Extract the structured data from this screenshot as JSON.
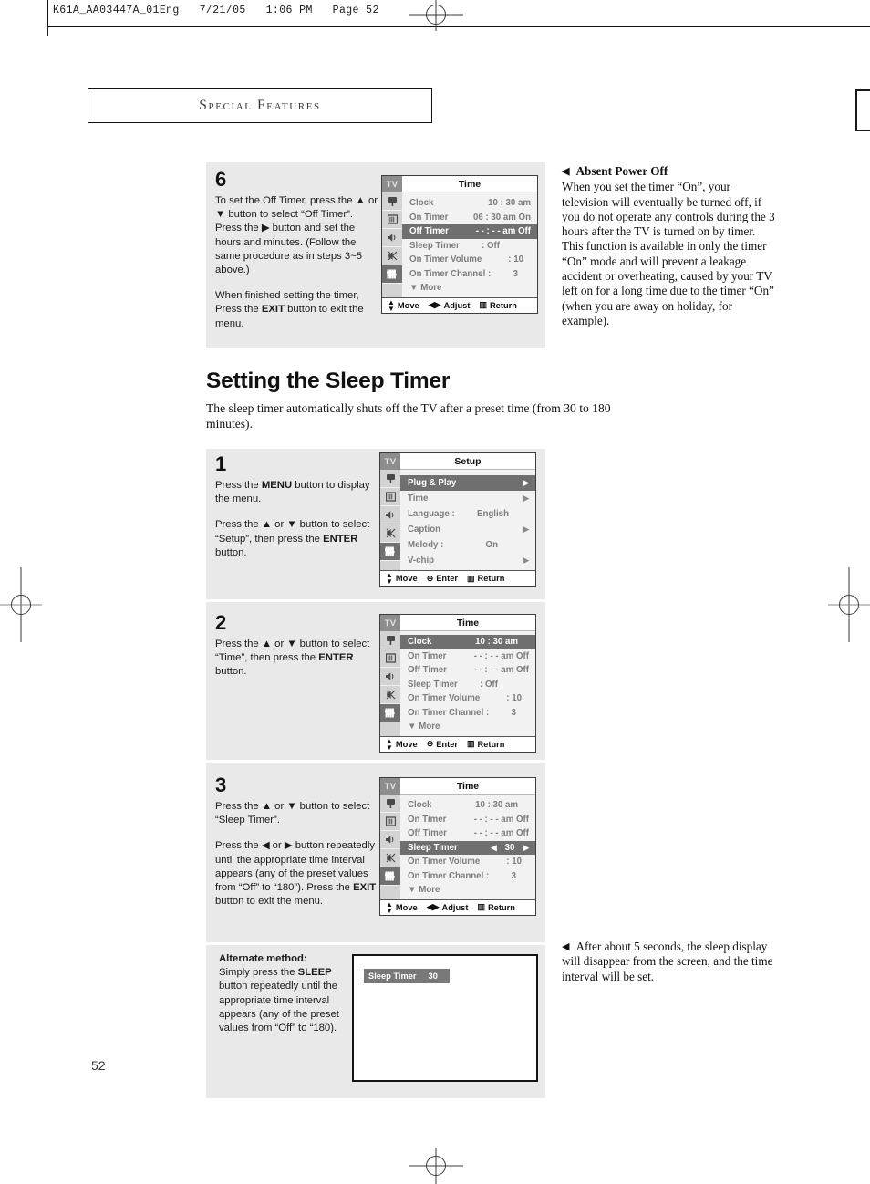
{
  "print_header": "K61A_AA03447A_01Eng   7/21/05   1:06 PM   Page 52",
  "section_title": "Special Features",
  "page_number": "52",
  "main_heading": "Setting the Sleep Timer",
  "main_intro": "The sleep timer automatically shuts off the TV after a preset time (from 30 to 180 minutes).",
  "step6": {
    "number": "6",
    "para1": "To set the Off Timer, press the ▲ or ▼ button to select “Off Timer”. Press the ▶ button and set the hours and minutes. (Follow the same procedure as in steps 3~5 above.)",
    "para2_pre": "When finished setting the timer, Press the ",
    "para2_bold": "EXIT",
    "para2_post": " button to exit the menu."
  },
  "step1": {
    "number": "1",
    "para1_pre": "Press the ",
    "para1_bold": "MENU",
    "para1_post": " button to display the menu.",
    "para2_pre": "Press the ▲ or ▼ button to select “Setup”, then press the ",
    "para2_bold": "ENTER",
    "para2_post": " button."
  },
  "step2": {
    "number": "2",
    "para1_pre": "Press the ▲ or ▼ button to select “Time”, then press the ",
    "para1_bold": "ENTER",
    "para1_post": " button."
  },
  "step3": {
    "number": "3",
    "para1": "Press the ▲ or ▼ button to select “Sleep Timer”.",
    "para2_pre": "Press the ◀ or ▶ button repeatedly until the appropriate time interval appears (any of the preset values from “Off” to “180”). Press the ",
    "para2_bold": "EXIT",
    "para2_post": " button to exit the menu."
  },
  "alternate": {
    "heading": "Alternate method:",
    "body_pre": "Simply press the ",
    "body_bold": "SLEEP",
    "body_post": " button repeatedly until the appropriate time interval appears (any of the preset values from “Off” to “180)."
  },
  "notes": {
    "absent_power_off": {
      "marker": "◀",
      "heading": "Absent Power Off",
      "body": "When you set the timer “On”, your television will eventually be turned off, if you do not operate any controls during the 3 hours after the TV is turned on by timer. This function is available in only the timer “On” mode and will prevent a leakage accident or overheating, caused by your TV left on for a long time due to the timer “On” (when you are away on holiday, for example)."
    },
    "sleep_display": {
      "marker": "◀",
      "body": "After about 5 seconds, the sleep display will disappear from the screen, and the time interval will be set."
    }
  },
  "osd_common": {
    "tv_label": "TV",
    "move_label": "Move",
    "adjust_label": "Adjust",
    "enter_label": "Enter",
    "return_label": "Return"
  },
  "osd_time_offtimer": {
    "title": "Time",
    "rows": [
      {
        "label": "Clock",
        "value": "10 : 30 am",
        "highlight": false
      },
      {
        "label": "On Timer",
        "value": "06 : 30 am On",
        "highlight": false
      },
      {
        "label": "Off Timer",
        "value": "- - : - - am Off",
        "highlight": true
      },
      {
        "label": "Sleep Timer",
        "value": ": Off",
        "highlight": false
      },
      {
        "label": "On Timer Volume",
        "value": ": 10",
        "highlight": false
      },
      {
        "label": "On Timer Channel :",
        "value": "3",
        "highlight": false
      },
      {
        "label": "▼ More",
        "value": "",
        "highlight": false
      }
    ],
    "footer": [
      "Move",
      "Adjust",
      "Return"
    ]
  },
  "osd_setup": {
    "title": "Setup",
    "rows": [
      {
        "label": "Plug & Play",
        "value": "",
        "arrow": true,
        "highlight": true
      },
      {
        "label": "Time",
        "value": "",
        "arrow": true,
        "highlight": false
      },
      {
        "label": "Language :",
        "value": "English",
        "arrow": false,
        "highlight": false
      },
      {
        "label": "Caption",
        "value": "",
        "arrow": true,
        "highlight": false
      },
      {
        "label": "Melody    :",
        "value": "On",
        "arrow": false,
        "highlight": false
      },
      {
        "label": "V-chip",
        "value": "",
        "arrow": true,
        "highlight": false
      }
    ],
    "footer": [
      "Move",
      "Enter",
      "Return"
    ]
  },
  "osd_time_clock": {
    "title": "Time",
    "rows": [
      {
        "label": "Clock",
        "value": "10 : 30 am",
        "highlight": true
      },
      {
        "label": "On Timer",
        "value": "- - : - - am Off",
        "highlight": false
      },
      {
        "label": "Off Timer",
        "value": "- - : - - am Off",
        "highlight": false
      },
      {
        "label": "Sleep Timer",
        "value": ": Off",
        "highlight": false
      },
      {
        "label": "On Timer Volume",
        "value": ": 10",
        "highlight": false
      },
      {
        "label": "On Timer Channel :",
        "value": "3",
        "highlight": false
      },
      {
        "label": "▼ More",
        "value": "",
        "highlight": false
      }
    ],
    "footer": [
      "Move",
      "Enter",
      "Return"
    ]
  },
  "osd_time_sleep": {
    "title": "Time",
    "rows": [
      {
        "label": "Clock",
        "value": "10 : 30 am",
        "highlight": false
      },
      {
        "label": "On Timer",
        "value": "- - : - - am Off",
        "highlight": false
      },
      {
        "label": "Off Timer",
        "value": "- - : - - am Off",
        "highlight": false
      },
      {
        "label": "Sleep Timer",
        "value": "30",
        "highlight": true,
        "adjust": true
      },
      {
        "label": "On Timer Volume",
        "value": ": 10",
        "highlight": false
      },
      {
        "label": "On Timer Channel :",
        "value": "3",
        "highlight": false
      },
      {
        "label": "▼ More",
        "value": "",
        "highlight": false
      }
    ],
    "footer": [
      "Move",
      "Adjust",
      "Return"
    ]
  },
  "tv_screen": {
    "badge_label": "Sleep Timer",
    "badge_value": "30"
  },
  "colors": {
    "panel_gray": "#e9e9e9",
    "osd_highlight": "#6f6f6f",
    "osd_text": "#7d7d7d",
    "badge_gray": "#787878"
  }
}
